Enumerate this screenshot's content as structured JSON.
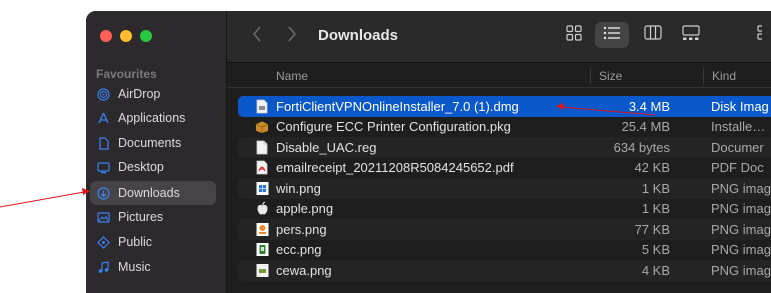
{
  "window": {
    "title": "Downloads",
    "traffic_lights": [
      "close",
      "minimize",
      "zoom"
    ]
  },
  "sidebar": {
    "section_title": "Favourites",
    "items": [
      {
        "label": "AirDrop",
        "icon": "airdrop-icon",
        "selected": false
      },
      {
        "label": "Applications",
        "icon": "applications-icon",
        "selected": false
      },
      {
        "label": "Documents",
        "icon": "document-icon",
        "selected": false
      },
      {
        "label": "Desktop",
        "icon": "desktop-icon",
        "selected": false
      },
      {
        "label": "Downloads",
        "icon": "download-icon",
        "selected": true
      },
      {
        "label": "Pictures",
        "icon": "pictures-icon",
        "selected": false
      },
      {
        "label": "Public",
        "icon": "public-icon",
        "selected": false
      },
      {
        "label": "Music",
        "icon": "music-icon",
        "selected": false
      }
    ]
  },
  "toolbar": {
    "back_icon": "chevron-left-icon",
    "forward_icon": "chevron-right-icon",
    "views": [
      {
        "icon": "icon-view-icon",
        "active": false
      },
      {
        "icon": "list-view-icon",
        "active": true
      },
      {
        "icon": "column-view-icon",
        "active": false
      },
      {
        "icon": "gallery-view-icon",
        "active": false
      }
    ]
  },
  "columns": {
    "name": "Name",
    "size": "Size",
    "kind": "Kind"
  },
  "files": [
    {
      "name": "FortiClientVPNOnlineInstaller_7.0 (1).dmg",
      "size": "3.4 MB",
      "kind": "Disk Imag",
      "icon": "dmg-icon",
      "selected": true
    },
    {
      "name": "Configure ECC Printer Configuration.pkg",
      "size": "25.4 MB",
      "kind": "Installe…",
      "icon": "package-icon",
      "selected": false
    },
    {
      "name": "Disable_UAC.reg",
      "size": "634 bytes",
      "kind": "Documer",
      "icon": "document-file-icon",
      "selected": false
    },
    {
      "name": "emailreceipt_20211208R5084245652.pdf",
      "size": "42 KB",
      "kind": "PDF Doc",
      "icon": "pdf-icon",
      "selected": false
    },
    {
      "name": "win.png",
      "size": "1 KB",
      "kind": "PNG imag",
      "icon": "windows-logo-icon",
      "selected": false
    },
    {
      "name": "apple.png",
      "size": "1 KB",
      "kind": "PNG imag",
      "icon": "apple-logo-icon",
      "selected": false
    },
    {
      "name": "pers.png",
      "size": "77 KB",
      "kind": "PNG imag",
      "icon": "image-file-icon",
      "selected": false
    },
    {
      "name": "ecc.png",
      "size": "5 KB",
      "kind": "PNG imag",
      "icon": "image-file-icon",
      "selected": false
    },
    {
      "name": "cewa.png",
      "size": "4 KB",
      "kind": "PNG imag",
      "icon": "image-file-icon",
      "selected": false
    }
  ],
  "colors": {
    "selection": "#0a58ca",
    "sidebar_icon": "#3b82f6",
    "annotation_arrow": "#e0161c"
  }
}
